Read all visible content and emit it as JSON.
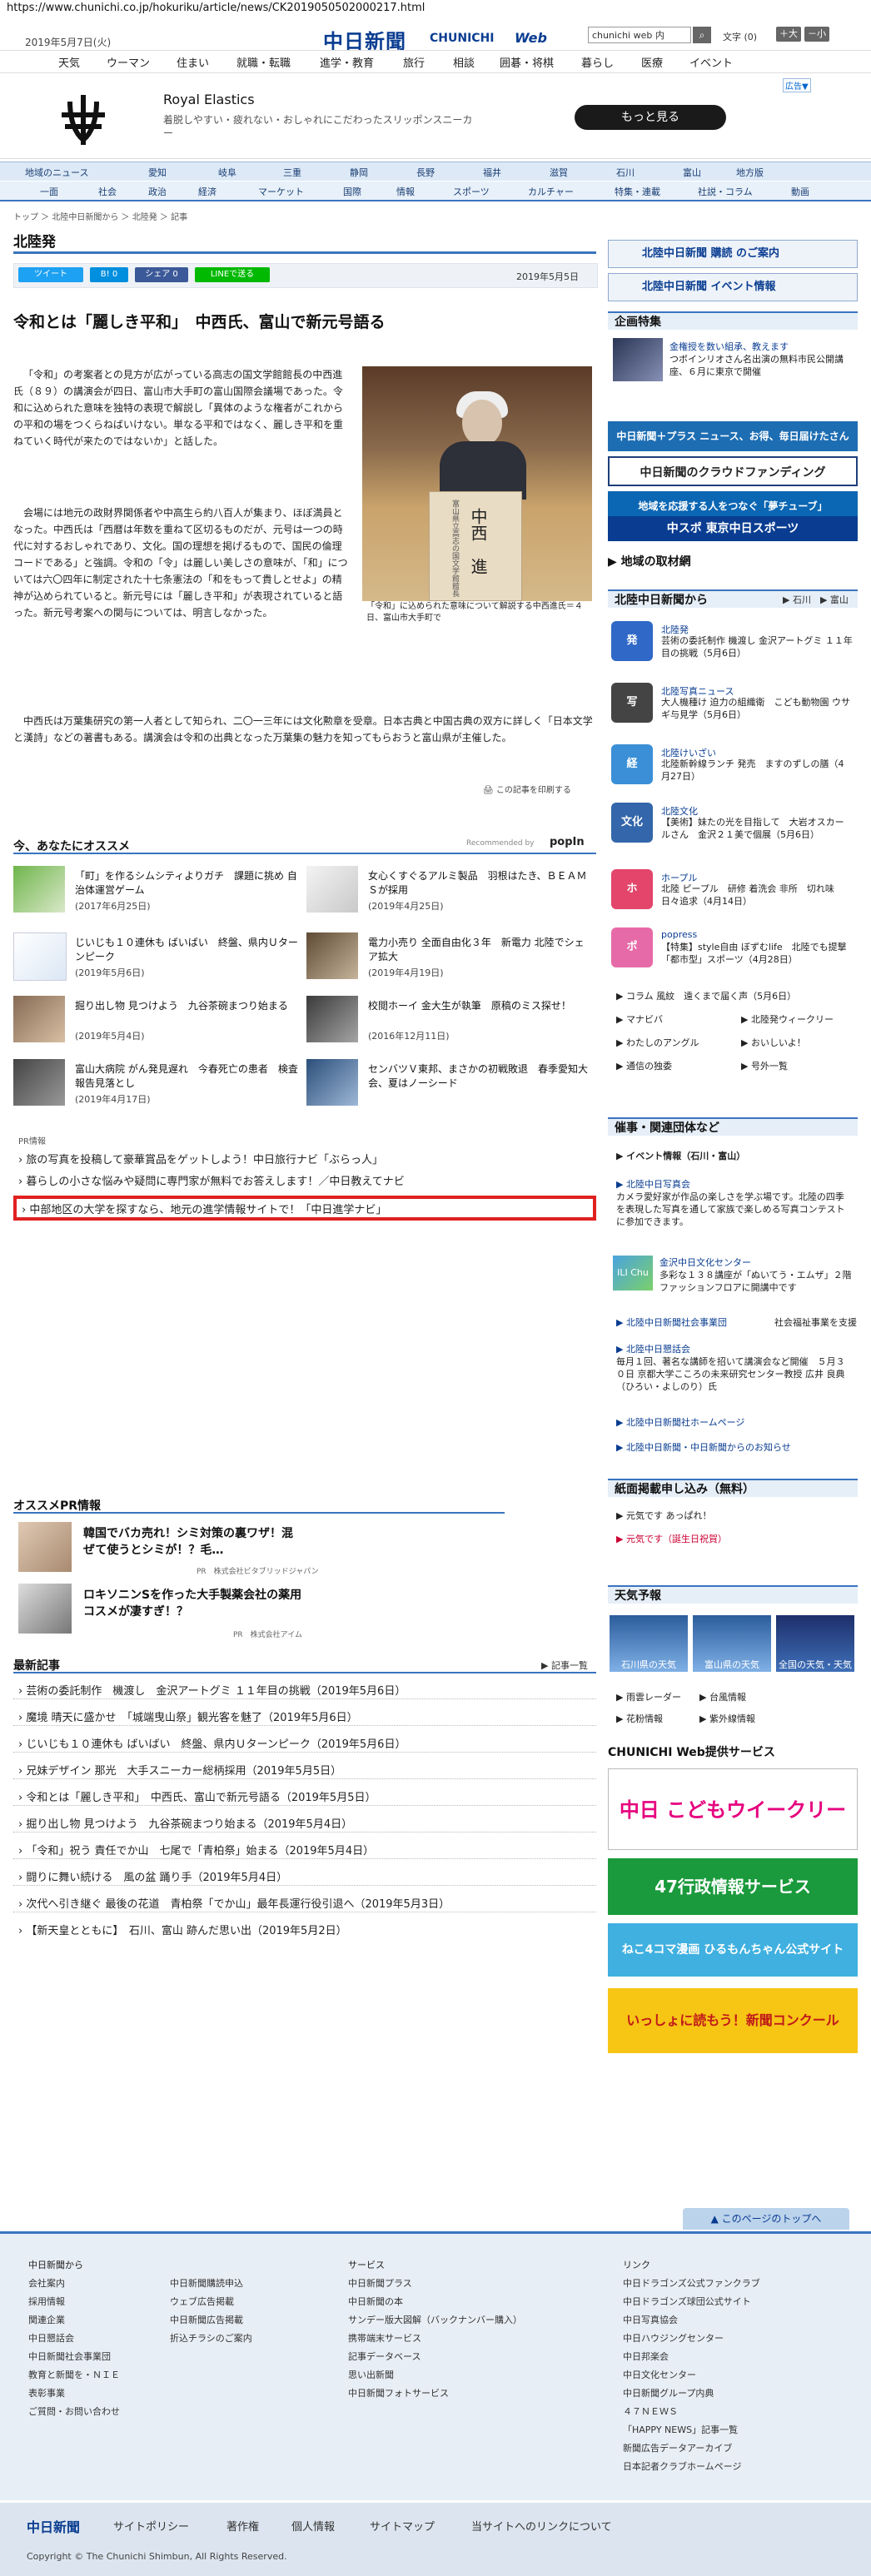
{
  "url": "https://www.chunichi.co.jp/hokuriku/article/news/CK2019050502000217.html",
  "header": {
    "date": "2019年5月7日(火)",
    "logo": "中日新聞",
    "logo_sub": "CHUNICHI",
    "logo_web": "Web",
    "search_value": "chunichi web 内",
    "fontsize_label": "文字 (0)",
    "fs_plus": "＋大",
    "fs_minus": "－小"
  },
  "gnav": [
    "天気",
    "ウーマン",
    "住まい",
    "就職・転職",
    "進学・教育",
    "旅行",
    "相談",
    "囲碁・将棋",
    "暮らし",
    "医療",
    "イベント"
  ],
  "ad": {
    "mark": "広告▼",
    "title": "Royal Elastics",
    "desc": "着脱しやすい・疲れない・おしゃれにこだわったスリッポンスニーカー",
    "cta": "もっと見る"
  },
  "rnav": [
    "地域のニュース",
    "愛知",
    "岐阜",
    "三重",
    "静岡",
    "長野",
    "福井",
    "滋賀",
    "石川",
    "富山",
    "地方版"
  ],
  "cnav": [
    "一面",
    "社会",
    "政治",
    "経済",
    "マーケット",
    "国際",
    "情報",
    "スポーツ",
    "カルチャー",
    "特集・連載",
    "社説・コラム",
    "動画"
  ],
  "breadcrumb": "トップ ＞ 北陸中日新聞から ＞ 北陸発 ＞ 記事",
  "section_title": "北陸発",
  "share": {
    "tweet": "ツイート",
    "hatena": "B! 0",
    "fb": "シェア 0",
    "line": "LINEで送る"
  },
  "article": {
    "date": "2019年5月5日",
    "headline": "令和とは「麗しき平和」　中西氏、富山で新元号語る",
    "photo_podium": "中西　進",
    "photo_podium_small": "富山県立高志の国文学館館長",
    "caption": "「令和」に込められた意味について解説する中西進氏＝４日、富山市大手町で",
    "p1": "「令和」の考案者との見方が広がっている高志の国文学館館長の中西進氏（８９）の講演会が四日、富山市大手町の富山国際会議場であった。令和に込められた意味を独特の表現で解説し「異体のような権者がこれからの平和の場をつくらねばいけない。単なる平和ではなく、麗しき平和を重ねていく時代が来たのではないか」と話した。",
    "p2": "会場には地元の政財界関係者や中高生ら約八百人が集まり、ほぼ満員となった。中西氏は「西暦は年数を重ねて区切るものだが、元号は一つの時代に対するおしゃれであり、文化。国の理想を掲げるもので、国民の倫理コードである」と強調。令和の「令」は麗しい美しさの意味が、「和」については六〇四年に制定された十七条憲法の「和をもって貴しとせよ」の精神が込められていると。新元号には「麗しき平和」が表現されていると語った。新元号考案への関与については、明言しなかった。",
    "p3": "中西氏は万葉集研究の第一人者として知られ、二〇一三年には文化勲章を受章。日本古典と中国古典の双方に詳しく「日本文学と漢詩」などの著書もある。講演会は令和の出典となった万葉集の魅力を知ってもらおうと富山県が主催した。",
    "print": "この記事を印刷する"
  },
  "recommend": {
    "title": "今、あなたにオススメ",
    "by": "Recommended by",
    "logo": "popIn",
    "items": [
      {
        "text": "「町」を作るシムシティよりガチ　課題に挑め 自治体運営ゲーム",
        "date": "(2017年6月25日)"
      },
      {
        "text": "女心くすぐるアルミ製品　羽根はたき、ＢＥＡＭＳが採用",
        "date": "(2019年4月25日)"
      },
      {
        "text": "じいじも１０連休も ばいばい　終盤、県内Ｕターンピーク",
        "date": "(2019年5月6日)"
      },
      {
        "text": "電力小売り 全面自由化３年　新電力 北陸でシェア拡大",
        "date": "(2019年4月19日)"
      },
      {
        "text": "掘り出し物 見つけよう　九谷茶碗まつり始まる",
        "date": "(2019年5月4日)"
      },
      {
        "text": "校閲ホーイ 金大生が執筆　原稿のミス探せ！",
        "date": "(2016年12月11日)"
      },
      {
        "text": "富山大病院 がん発見遅れ　今春死亡の患者　検査報告見落とし",
        "date": "(2019年4月17日)"
      },
      {
        "text": "センバツＶ東邦、まさかの初戦敗退　春季愛知大会、夏はノーシード",
        "date": ""
      }
    ]
  },
  "pr": {
    "label": "PR情報",
    "links": [
      "旅の写真を投稿して豪華賞品をゲットしよう！中日旅行ナビ「ぶらっ人」",
      "暮らしの小さな悩みや疑問に専門家が無料でお答えします！／中日教えてナビ",
      "中部地区の大学を探すなら、地元の進学情報サイトで！「中日進学ナビ」"
    ]
  },
  "osusume_pr": {
    "title": "オススメPR情報",
    "items": [
      {
        "text": "韓国でバカ売れ！シミ対策の裏ワザ！混ぜて使うとシミが！？毛…",
        "sub": "PR　株式会社ビタブリッドジャパン"
      },
      {
        "text": "ロキソニンSを作った大手製薬会社の薬用コスメが凄すぎ！？",
        "sub": "PR　株式会社アイム"
      }
    ]
  },
  "latest": {
    "title": "最新記事",
    "more": "▶ 記事一覧",
    "items": [
      "芸術の委託制作　機渡し　金沢アートグミ １１年目の挑戦（2019年5月6日）",
      "魔境 晴天に盛かせ　「城端曳山祭」観光客を魅了（2019年5月6日）",
      "じいじも１０連休も ばいばい　終盤、県内Ｕターンピーク（2019年5月6日）",
      "兄妹デザイン 那光　大手スニーカー総柄採用（2019年5月5日）",
      "令和とは「麗しき平和」　中西氏、富山で新元号語る（2019年5月5日）",
      "掘り出し物 見つけよう　九谷茶碗まつり始まる（2019年5月4日）",
      "「令和」祝う 責任でか山　七尾で「青柏祭」始まる（2019年5月4日）",
      "闘りに舞い続ける　風の盆 踊り手（2019年5月4日）",
      "次代へ引き継ぐ 最後の花道　青柏祭「でか山」最年長運行役引退へ（2019年5月3日）",
      "【新天皇とともに】　石川、富山 跡んだ思い出（2019年5月2日）"
    ]
  },
  "right": {
    "subscribe": "北陸中日新聞 購読 のご案内",
    "event_info": "北陸中日新聞 イベント情報",
    "kikaku_title": "企画特集",
    "kikaku_head": "金権授を数い組承、教えます",
    "kikaku_text": "つボインリオさん名出演の無料市民公開講座、６月に東京で開催",
    "banner_plus": "中日新聞＋プラス ニュース、お得、毎日届けたさん",
    "banner_cloud": "中日新聞のクラウドファンディング",
    "banner_yume": "地域を応援する人をつなぐ「夢チューブ」",
    "banner_chuspo": "中スポ 東京中日スポーツ",
    "torizai": "地域の取材網",
    "hokuriku_from": "北陸中日新聞から",
    "hokuriku_links": "▶ 石川　▶ 富山",
    "from_items": [
      {
        "icon": "発",
        "title": "北陸発",
        "text": "芸術の委託制作 機渡し 金沢アートグミ １１年目の挑戦（5月6日）",
        "color": "#2f68c6"
      },
      {
        "icon": "写",
        "title": "北陸写真ニュース",
        "text": "大人機種け 迫力の組織衛　こども動物園 ウサギ与見学（5月6日）",
        "color": "#444"
      },
      {
        "icon": "経",
        "title": "北陸けいざい",
        "text": "北陸新幹線ランチ 発売　ますのずしの膳（4月27日）",
        "color": "#3a8fd6"
      },
      {
        "icon": "文化",
        "title": "北陸文化",
        "text": "【美術】妹たの光を目指して　大岩オスカールさん　金沢２１美で個展（5月6日）",
        "color": "#3366aa"
      },
      {
        "icon": "ホ",
        "title": "ホープル",
        "text": "北陸 ピープル　研修 着洗会 ⾮所　切れ味 日々追求（4月14日）",
        "color": "#e3456b"
      },
      {
        "icon": "ポ",
        "title": "popress",
        "text": "【特集】style自由 ぼずむlife　北陸でも提撃「都市型」スポーツ（4月28日）",
        "color": "#e66aa7"
      }
    ],
    "column_items": [
      "コラム 風紋　遠くまで届く声（5月6日）",
      "マナビバ",
      "北陸発ウィークリー",
      "わたしのアングル",
      "おいしいよ！",
      "通信の独委",
      "号外一覧"
    ],
    "events_title": "催事・関連団体など",
    "events_sub": "イベント情報（石川・富山）",
    "event_items": [
      {
        "title": "北陸中日写真会",
        "text": "カメラ愛好家が作品の楽しさを学ぶ場です。北陸の四季を表現した写真を通して家族で楽しめる写真コンテストに参加できます。"
      },
      {
        "title": "金沢中日文化センター",
        "text": "多彩な１３８講座が「ぬいてう・エムザ」２階ファッションフロアに開講中です"
      },
      {
        "title": "北陸中日新聞社会事業団",
        "text": "社会福祉事業を支援"
      },
      {
        "title": "北陸中日懇話会",
        "text": "毎月１回、著名な講師を招いて講演会など開催　５月３０日 京都大学こころの未来研究センター教授 広井 良典（ひろい・よしのり）氏"
      },
      {
        "title": "北陸中日新聞社ホームページ",
        "text": ""
      },
      {
        "title": "北陸中日新聞・中日新聞からのお知らせ",
        "text": ""
      }
    ],
    "shimen_title": "紙面掲載申し込み（無料）",
    "shimen_items": [
      "元気です あっぱれ！",
      "元気です（誕生日祝賀）"
    ],
    "tenki_title": "天気予報",
    "weather_labels": [
      "石川県の天気",
      "富山県の天気",
      "全国の天気・天気"
    ],
    "weather_links": [
      "雨雲レーダー",
      "台風情報",
      "花粉情報",
      "紫外線情報"
    ],
    "svc_title": "CHUNICHI Web提供サービス",
    "svc_kodomo": "中日 こどもウイークリー",
    "svc_gyosei": "47行政情報サービス",
    "svc_hiru": "ねこ4コマ漫画 ひるもんちゃん公式サイト",
    "svc_nie": "いっしょに読もう！新聞コンクール"
  },
  "topbtn": "このページのトップへ",
  "footer": {
    "col1_title": "中日新聞から",
    "col1": [
      "会社案内",
      "採用情報",
      "関連企業",
      "中日懇話会",
      "中日新聞社会事業団",
      "教育と新聞を・ＮＩＥ",
      "表彰事業",
      "ご質問・お問い合わせ"
    ],
    "col2": [
      "中日新聞購読申込",
      "ウェブ広告掲載",
      "中日新聞広告掲載",
      "折込チラシのご案内"
    ],
    "col3_title": "サービス",
    "col3": [
      "中日新聞プラス",
      "中日新聞の本",
      "サンデー版大図解（バックナンバー購入）",
      "携帯端末サービス",
      "記事データベース",
      "思い出新聞",
      "中日新聞フォトサービス"
    ],
    "col4_title": "リンク",
    "col4": [
      "中日ドラゴンズ公式ファンクラブ",
      "中日ドラゴンズ球団公式サイト",
      "中日写真協会",
      "中日ハウジングセンター",
      "中日邦楽会",
      "中日文化センター",
      "中日新聞グループ内典",
      "４７ＮＥＷＳ",
      "「HAPPY NEWS」記事一覧",
      "新聞広告データアーカイブ",
      "日本記者クラブホームページ"
    ],
    "logo": "中日新聞",
    "links": [
      "サイトポリシー",
      "著作権",
      "個人情報",
      "サイトマップ",
      "当サイトへのリンクについて"
    ],
    "copyright": "Copyright © The Chunichi Shimbun, All Rights Reserved."
  }
}
